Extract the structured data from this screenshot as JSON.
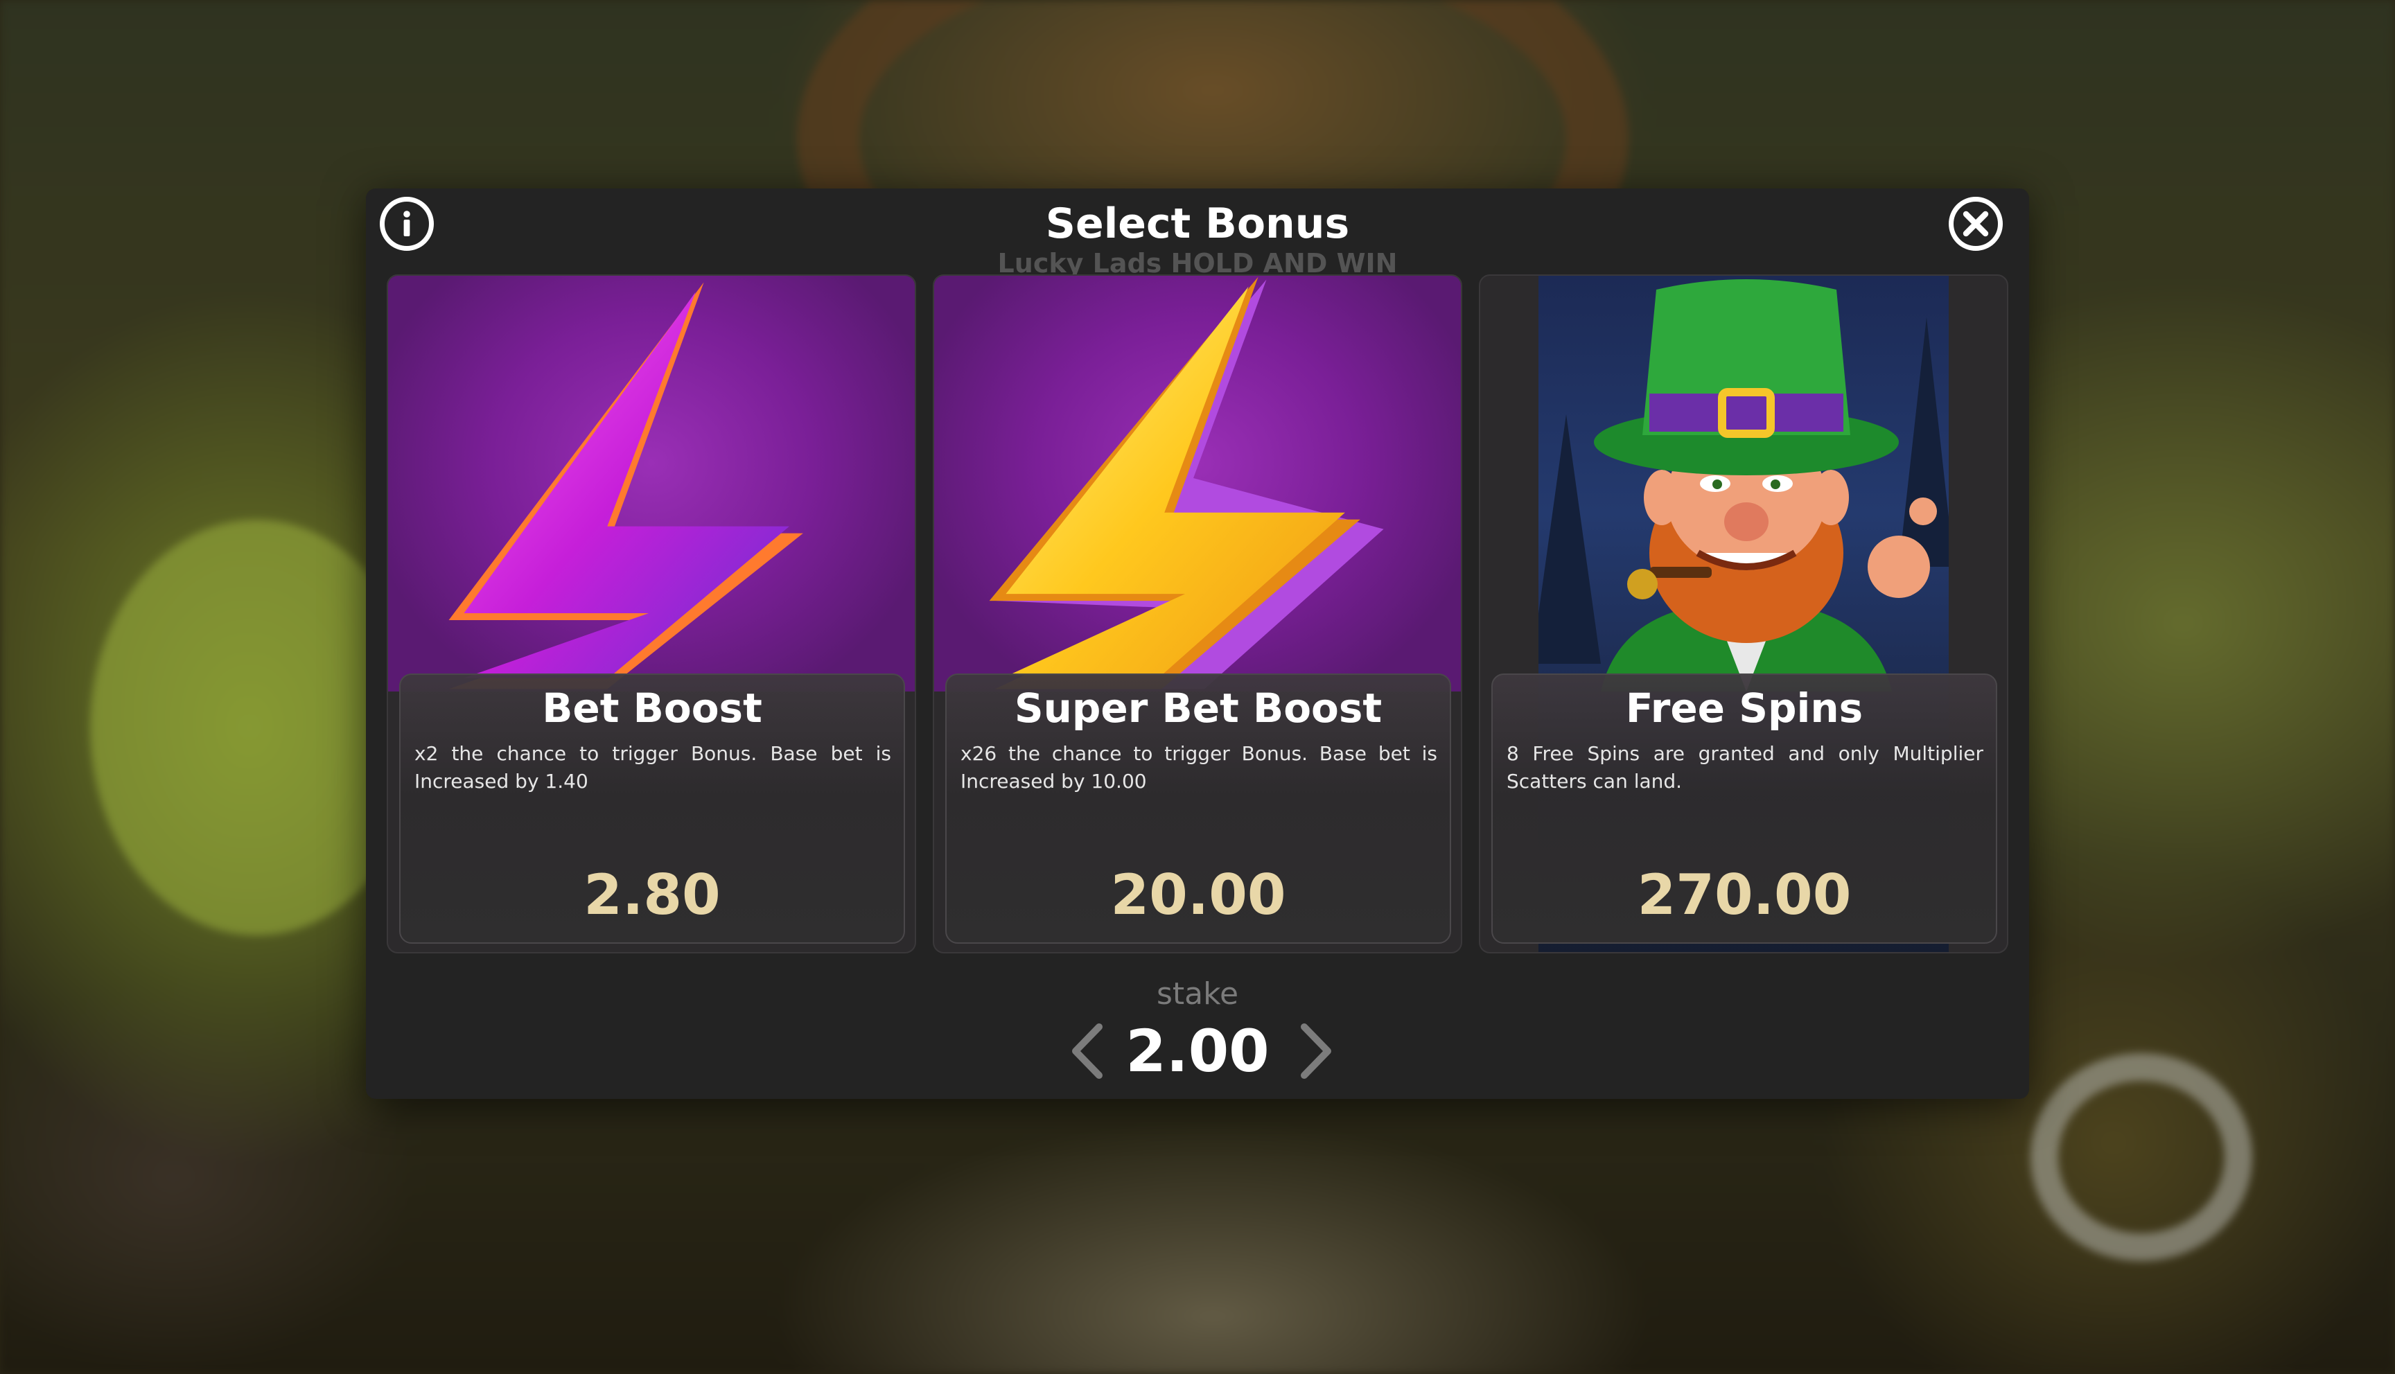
{
  "dialog": {
    "title": "Select Bonus",
    "subtitle": "Lucky Lads HOLD AND WIN"
  },
  "icons": {
    "info": "info-icon",
    "close": "close-icon",
    "prev": "chevron-left-icon",
    "next": "chevron-right-icon"
  },
  "cards": [
    {
      "title": "Bet Boost",
      "description": "x2 the chance to trigger Bonus. Base bet is Increased by 1.40",
      "price": "2.80",
      "art": "purple-lightning-bolt"
    },
    {
      "title": "Super Bet Boost",
      "description": "x26 the chance to trigger Bonus. Base bet is Increased by 10.00",
      "price": "20.00",
      "art": "gold-lightning-bolt"
    },
    {
      "title": "Free Spins",
      "description": "8 Free Spins are granted and only Multiplier Scatters can land.",
      "price": "270.00",
      "art": "leprechaun"
    }
  ],
  "stake": {
    "label": "stake",
    "value": "2.00"
  },
  "colors": {
    "dialog_bg": "#232323",
    "price": "#e8d7a8",
    "subtitle": "#545454",
    "card_purple": "#7a1f97"
  }
}
